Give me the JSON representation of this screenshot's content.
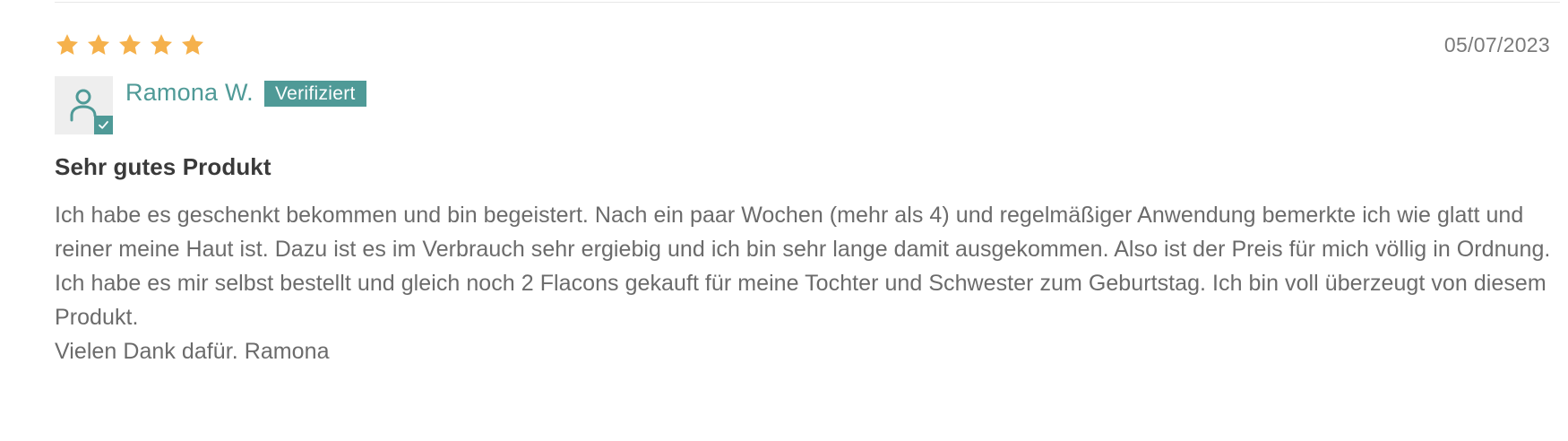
{
  "review": {
    "rating": 5,
    "rating_max": 5,
    "date": "05/07/2023",
    "author": {
      "name": "Ramona W.",
      "badge": "Verifiziert",
      "avatar_icon": "user-icon",
      "verified_icon": "checkmark-icon"
    },
    "title": "Sehr gutes Produkt",
    "body_lines": [
      "Ich habe es geschenkt bekommen und bin begeistert. Nach ein paar Wochen (mehr als 4) und regelmäßiger Anwendung bemerkte ich wie glatt und reiner meine Haut ist. Dazu ist es im Verbrauch sehr ergiebig und ich bin sehr lange damit ausgekommen. Also ist der Preis für mich völlig in Ordnung.",
      "Ich habe es mir selbst bestellt und gleich noch 2 Flacons gekauft für meine Tochter und Schwester zum Geburtstag. Ich bin voll überzeugt von diesem Produkt.",
      "Vielen Dank dafür. Ramona"
    ]
  },
  "colors": {
    "star": "#f5b14c",
    "accent": "#4f9a97",
    "text": "#6b6b6b",
    "title": "#3a3a3a",
    "muted": "#7a7a7a"
  }
}
